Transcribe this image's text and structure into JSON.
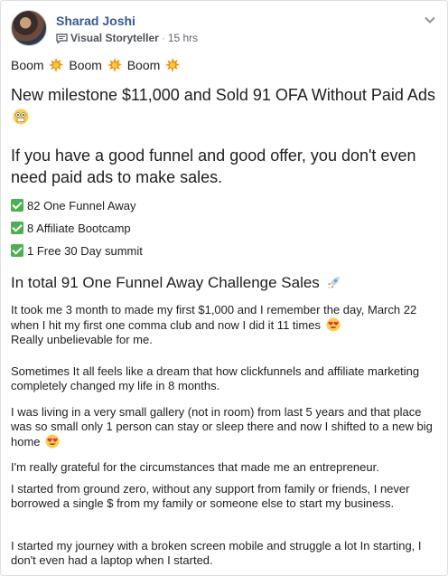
{
  "post": {
    "author_name": "Sharad Joshi",
    "badge_label": "Visual Storyteller",
    "time": "15 hrs",
    "boom_word": "Boom",
    "milestone_text": "New milestone $11,000 and Sold 91 OFA Without Paid Ads",
    "funnel_text": "If you have a good funnel and good offer, you don't even need paid ads to make sales.",
    "checklist": [
      "82 One Funnel Away",
      "8 Affiliate Bootcamp",
      "1 Free 30 Day summit"
    ],
    "total_text": "In total 91 One Funnel Away Challenge Sales",
    "para1a": "It took me 3 month to made my first $1,000 and I remember the day, March 22 when I hit my first one comma club and now I did it 11 times",
    "para1b": "Really unbelievable for me.",
    "para2": "Sometimes It all feels like a dream that how clickfunnels and affiliate marketing completely changed my life in 8 months.",
    "para3": "I was living in a very small gallery (not in room) from last 5 years and that place was so small only 1 person can stay or sleep there and now I shifted to a new big home",
    "para4": "I'm really grateful for the circumstances that made me an entrepreneur.",
    "para5": "I started from ground zero, without any support from family or friends, I never borrowed a single $ from my family or someone else to start my business.",
    "para6": "I started my journey with a broken screen mobile and struggle a lot In starting, I don't even had a laptop when I started."
  },
  "icons": {
    "boom": "collision-emoji",
    "milestone": "money-mouth-emoji",
    "rocket": "rocket-emoji",
    "heart_eyes": "heart-eyes-emoji",
    "check": "check-mark-emoji",
    "badge": "speech-bubble-icon",
    "options": "chevron-down-icon"
  },
  "colors": {
    "author_link": "#385898",
    "meta_text": "#616770",
    "check_green": "#4caf50"
  }
}
